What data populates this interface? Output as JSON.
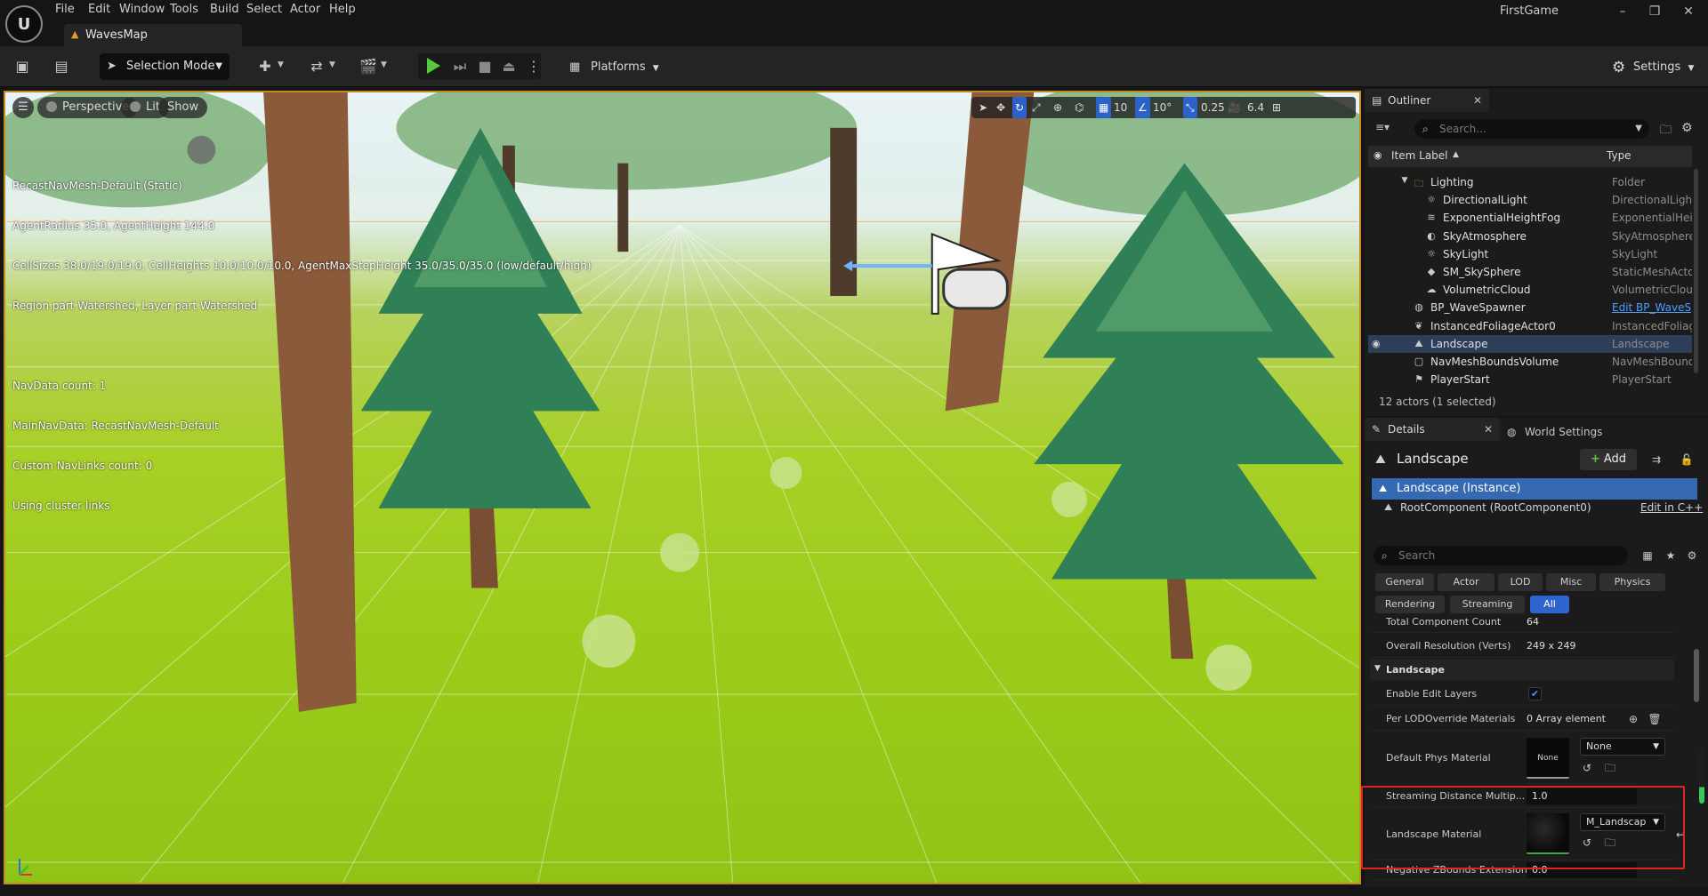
{
  "app": {
    "logo_letter": "U",
    "project_name": "FirstGame",
    "menu": [
      "File",
      "Edit",
      "Window",
      "Tools",
      "Build",
      "Select",
      "Actor",
      "Help"
    ],
    "map_tab": "WavesMap"
  },
  "toolbar": {
    "selection_mode": "Selection Mode",
    "platforms": "Platforms",
    "settings": "Settings"
  },
  "viewport": {
    "perspective": "Perspective",
    "lit": "Lit",
    "show": "Show",
    "grid_snap": "10",
    "rotation_snap": "10°",
    "scale_snap": "0.25",
    "camera_speed": "6.4",
    "nav_debug": [
      "RecastNavMesh-Default (Static)",
      "AgentRadius 35.0, AgentHeight 144.0",
      "CellSizes 38.0/19.0/19.0, CellHeights 10.0/10.0/10.0, AgentMaxStepHeight 35.0/35.0/35.0 (low/default/high)",
      "Region part Watershed, Layer part Watershed",
      "",
      "NavData count: 1",
      "MainNavData: RecastNavMesh-Default",
      "Custom NavLinks count: 0",
      "Using cluster links"
    ]
  },
  "outliner": {
    "title": "Outliner",
    "search_placeholder": "Search...",
    "col_label": "Item Label",
    "col_type": "Type",
    "rows": [
      {
        "label": "Lighting",
        "type": "Folder",
        "indent": 2,
        "icon": "folder-icon"
      },
      {
        "label": "DirectionalLight",
        "type": "DirectionalLight",
        "indent": 3,
        "icon": "light-icon"
      },
      {
        "label": "ExponentialHeightFog",
        "type": "ExponentialHeightFog",
        "indent": 3,
        "icon": "fog-icon"
      },
      {
        "label": "SkyAtmosphere",
        "type": "SkyAtmosphere",
        "indent": 3,
        "icon": "sky-icon"
      },
      {
        "label": "SkyLight",
        "type": "SkyLight",
        "indent": 3,
        "icon": "light-icon"
      },
      {
        "label": "SM_SkySphere",
        "type": "StaticMeshActor",
        "indent": 3,
        "icon": "mesh-icon"
      },
      {
        "label": "VolumetricCloud",
        "type": "VolumetricCloud",
        "indent": 3,
        "icon": "cloud-icon"
      },
      {
        "label": "BP_WaveSpawner",
        "type": "Edit BP_WaveSpawner",
        "indent": 2,
        "icon": "blueprint-icon",
        "link": true
      },
      {
        "label": "InstancedFoliageActor0",
        "type": "InstancedFoliageActor",
        "indent": 2,
        "icon": "foliage-icon"
      },
      {
        "label": "Landscape",
        "type": "Landscape",
        "indent": 2,
        "icon": "landscape-icon",
        "selected": true
      },
      {
        "label": "NavMeshBoundsVolume",
        "type": "NavMeshBoundsVolume",
        "indent": 2,
        "icon": "volume-icon"
      },
      {
        "label": "PlayerStart",
        "type": "PlayerStart",
        "indent": 2,
        "icon": "player-start-icon"
      }
    ],
    "footer": "12 actors (1 selected)"
  },
  "details": {
    "tab": "Details",
    "world_tab": "World Settings",
    "actor_name": "Landscape",
    "add": "Add",
    "component_instance": "Landscape (Instance)",
    "root_component": "RootComponent (RootComponent0)",
    "edit_cpp": "Edit in C++",
    "search_placeholder": "Search",
    "filters_row1": [
      "General",
      "Actor",
      "LOD",
      "Misc",
      "Physics"
    ],
    "filters_row2": [
      "Rendering",
      "Streaming",
      "All"
    ],
    "active_filter": "All",
    "props": {
      "total_component_count_label": "Total Component Count",
      "total_component_count": "64",
      "overall_resolution_label": "Overall Resolution (Verts)",
      "overall_resolution": "249 x 249",
      "section_landscape": "Landscape",
      "enable_edit_layers_label": "Enable Edit Layers",
      "enable_edit_layers": true,
      "per_lod_label": "Per LODOverride Materials",
      "per_lod": "0 Array element",
      "default_phys_label": "Default Phys Material",
      "default_phys_thumb": "None",
      "default_phys_value": "None",
      "streaming_label": "Streaming Distance Multip...",
      "streaming_value": "1.0",
      "landscape_material_label": "Landscape Material",
      "landscape_material_value": "M_Landscap",
      "neg_zbounds_label": "Negative ZBounds Extension",
      "neg_zbounds_value": "0.0"
    }
  },
  "colors": {
    "accent_blue": "#2f63cf",
    "selection_orange": "#c28c1e",
    "highlight_red": "#e02424",
    "play_green": "#5ac83c"
  }
}
